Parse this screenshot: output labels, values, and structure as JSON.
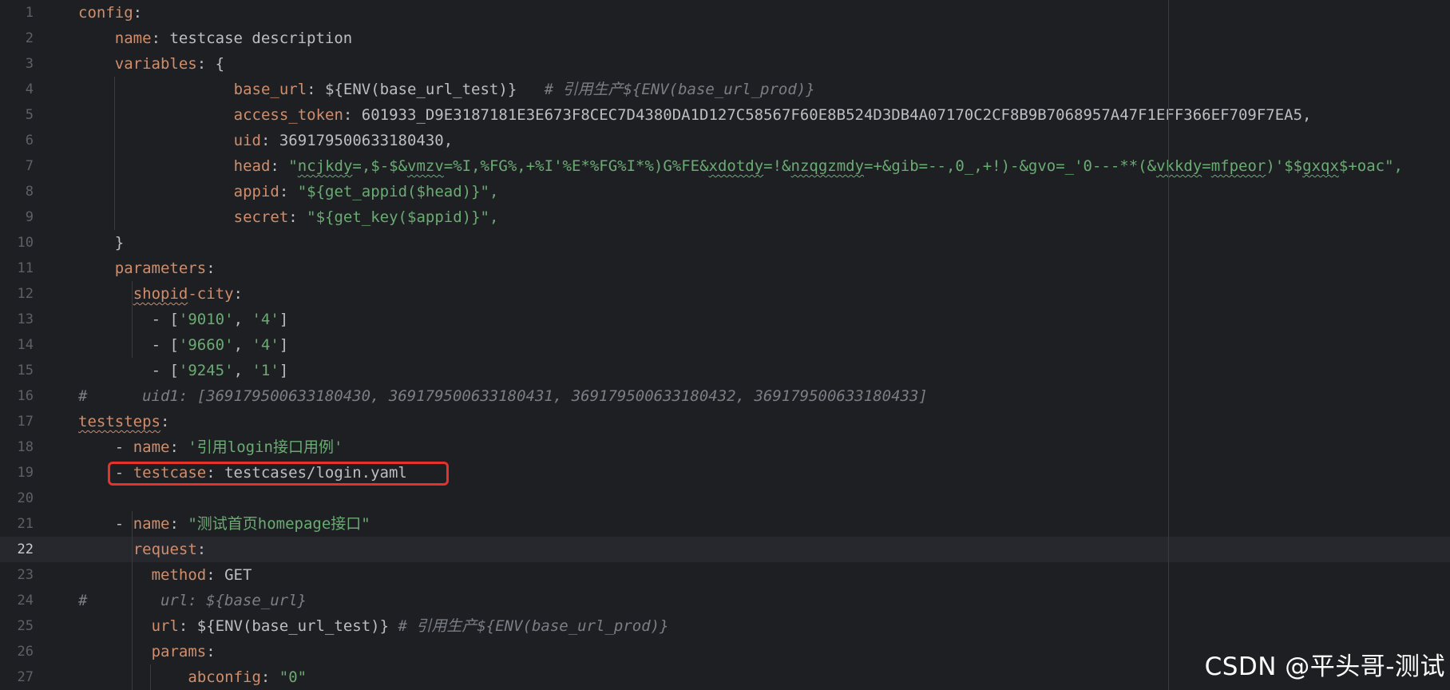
{
  "watermark": "CSDN @平头哥-测试",
  "lines": [
    {
      "n": "1",
      "indent": 0,
      "segs": [
        {
          "t": "config",
          "c": "key"
        },
        {
          "t": ":",
          "c": "plain"
        }
      ]
    },
    {
      "n": "2",
      "indent": 4,
      "segs": [
        {
          "t": "name",
          "c": "key"
        },
        {
          "t": ": testcase description",
          "c": "plain"
        }
      ]
    },
    {
      "n": "3",
      "indent": 4,
      "segs": [
        {
          "t": "variables",
          "c": "key"
        },
        {
          "t": ": {",
          "c": "plain"
        }
      ]
    },
    {
      "n": "4",
      "indent": 17,
      "segs": [
        {
          "t": "base_url",
          "c": "key"
        },
        {
          "t": ": ${ENV(base_url_test)}   ",
          "c": "plain"
        },
        {
          "t": "# 引用生产${ENV(base_url_prod)}",
          "c": "cmt"
        }
      ]
    },
    {
      "n": "5",
      "indent": 17,
      "segs": [
        {
          "t": "access_token",
          "c": "key"
        },
        {
          "t": ": 601933_D9E3187181E3E673F8CEC7D4380DA1D127C58567F60E8B524D3DB4A07170C2CF8B9B7068957A47F1EFF366EF709F7EA5,",
          "c": "plain"
        }
      ]
    },
    {
      "n": "6",
      "indent": 17,
      "segs": [
        {
          "t": "uid",
          "c": "key"
        },
        {
          "t": ": 369179500633180430,",
          "c": "plain"
        }
      ]
    },
    {
      "n": "7",
      "indent": 17,
      "segs": [
        {
          "t": "head",
          "c": "key"
        },
        {
          "t": ": ",
          "c": "plain"
        },
        {
          "t": "\"ncjkdy=,$-$&vmzv=%I,%FG%,+%I'%E*%FG%I*%)G%FE&xdotdy=!&nzqgzmdy=+&gib=--,0_,+!)-&gvo=_'0---**(&vkkdy=mfpeor)'$$gxqx$+oac\",",
          "c": "str"
        }
      ]
    },
    {
      "n": "8",
      "indent": 17,
      "segs": [
        {
          "t": "appid",
          "c": "key"
        },
        {
          "t": ": ",
          "c": "plain"
        },
        {
          "t": "\"${get_appid($head)}\",",
          "c": "str"
        }
      ]
    },
    {
      "n": "9",
      "indent": 17,
      "segs": [
        {
          "t": "secret",
          "c": "key"
        },
        {
          "t": ": ",
          "c": "plain"
        },
        {
          "t": "\"${get_key($appid)}\",",
          "c": "str"
        }
      ]
    },
    {
      "n": "10",
      "indent": 4,
      "segs": [
        {
          "t": "}",
          "c": "plain"
        }
      ]
    },
    {
      "n": "11",
      "indent": 4,
      "segs": [
        {
          "t": "parameters",
          "c": "key"
        },
        {
          "t": ":",
          "c": "plain"
        }
      ]
    },
    {
      "n": "12",
      "indent": 6,
      "segs": [
        {
          "t": "shopid",
          "c": "key",
          "w": "key"
        },
        {
          "t": "-city",
          "c": "key"
        },
        {
          "t": ":",
          "c": "plain"
        }
      ]
    },
    {
      "n": "13",
      "indent": 8,
      "segs": [
        {
          "t": "- [",
          "c": "plain"
        },
        {
          "t": "'9010'",
          "c": "str"
        },
        {
          "t": ", ",
          "c": "plain"
        },
        {
          "t": "'4'",
          "c": "str"
        },
        {
          "t": "]",
          "c": "plain"
        }
      ]
    },
    {
      "n": "14",
      "indent": 8,
      "segs": [
        {
          "t": "- [",
          "c": "plain"
        },
        {
          "t": "'9660'",
          "c": "str"
        },
        {
          "t": ", ",
          "c": "plain"
        },
        {
          "t": "'4'",
          "c": "str"
        },
        {
          "t": "]",
          "c": "plain"
        }
      ]
    },
    {
      "n": "15",
      "indent": 8,
      "segs": [
        {
          "t": "- [",
          "c": "plain"
        },
        {
          "t": "'9245'",
          "c": "str"
        },
        {
          "t": ", ",
          "c": "plain"
        },
        {
          "t": "'1'",
          "c": "str"
        },
        {
          "t": "]",
          "c": "plain"
        }
      ]
    },
    {
      "n": "16",
      "indent": 0,
      "segs": [
        {
          "t": "#      uid1: [369179500633180430, 369179500633180431, 369179500633180432, 369179500633180433]",
          "c": "cmt"
        }
      ]
    },
    {
      "n": "17",
      "indent": 0,
      "segs": [
        {
          "t": "teststeps",
          "c": "key",
          "w": "key"
        },
        {
          "t": ":",
          "c": "plain"
        }
      ]
    },
    {
      "n": "18",
      "indent": 4,
      "segs": [
        {
          "t": "- ",
          "c": "plain"
        },
        {
          "t": "name",
          "c": "key"
        },
        {
          "t": ": ",
          "c": "plain"
        },
        {
          "t": "'引用login接口用例'",
          "c": "str"
        }
      ]
    },
    {
      "n": "19",
      "indent": 4,
      "segs": [
        {
          "t": "- ",
          "c": "plain"
        },
        {
          "t": "testcase",
          "c": "key"
        },
        {
          "t": ": testcases/login.yaml",
          "c": "plain"
        }
      ]
    },
    {
      "n": "20",
      "indent": 0,
      "segs": []
    },
    {
      "n": "21",
      "indent": 4,
      "segs": [
        {
          "t": "- ",
          "c": "plain"
        },
        {
          "t": "name",
          "c": "key"
        },
        {
          "t": ": ",
          "c": "plain"
        },
        {
          "t": "\"测试首页homepage接口\"",
          "c": "str"
        }
      ]
    },
    {
      "n": "22",
      "indent": 6,
      "current": true,
      "segs": [
        {
          "t": "request",
          "c": "key"
        },
        {
          "t": ":",
          "c": "plain"
        }
      ]
    },
    {
      "n": "23",
      "indent": 8,
      "segs": [
        {
          "t": "method",
          "c": "key"
        },
        {
          "t": ": GET",
          "c": "plain"
        }
      ]
    },
    {
      "n": "24",
      "indent": 0,
      "segs": [
        {
          "t": "#        url: ${base_url}",
          "c": "cmt"
        }
      ]
    },
    {
      "n": "25",
      "indent": 8,
      "segs": [
        {
          "t": "url",
          "c": "key"
        },
        {
          "t": ": ${ENV(base_url_test)} ",
          "c": "plain"
        },
        {
          "t": "# 引用生产${ENV(base_url_prod)}",
          "c": "cmt"
        }
      ]
    },
    {
      "n": "26",
      "indent": 8,
      "segs": [
        {
          "t": "params",
          "c": "key"
        },
        {
          "t": ":",
          "c": "plain"
        }
      ]
    },
    {
      "n": "27",
      "indent": 12,
      "segs": [
        {
          "t": "abconfig",
          "c": "key"
        },
        {
          "t": ": ",
          "c": "plain"
        },
        {
          "t": "\"0\"",
          "c": "str"
        }
      ]
    }
  ],
  "wavy_words_line7": [
    "ncjkdy",
    "vmzv",
    "xdotdy",
    "nzqgzmdy",
    "vkkdy",
    "mfpeor",
    "gxqx"
  ]
}
